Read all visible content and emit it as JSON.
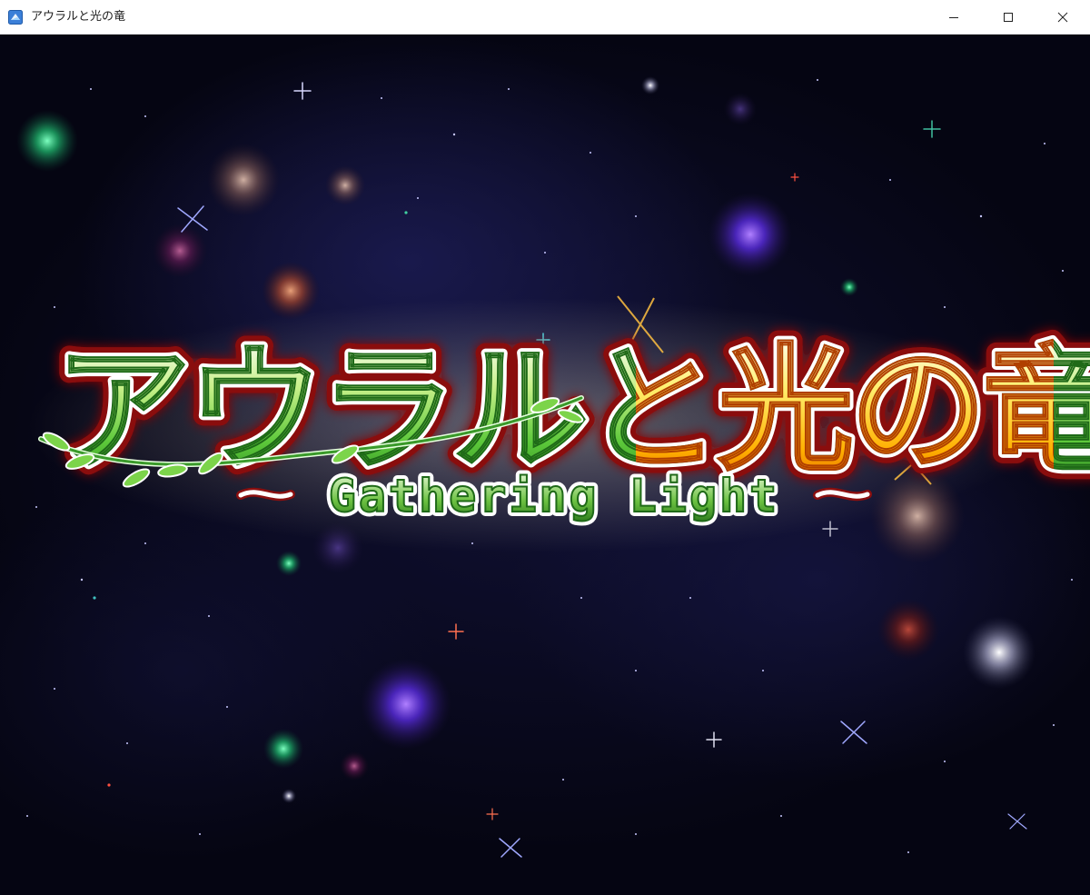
{
  "window": {
    "title": "アウラルと光の竜",
    "controls": [
      "minimize",
      "maximize",
      "close"
    ]
  },
  "game": {
    "logo": {
      "main_title": "アウラルと光の竜",
      "subtitle": "Gathering Light"
    },
    "colors": {
      "title_green": "#5ec93a",
      "title_gold": "#ffd21e",
      "outline_red": "#b01818",
      "background": "#06061a"
    }
  }
}
